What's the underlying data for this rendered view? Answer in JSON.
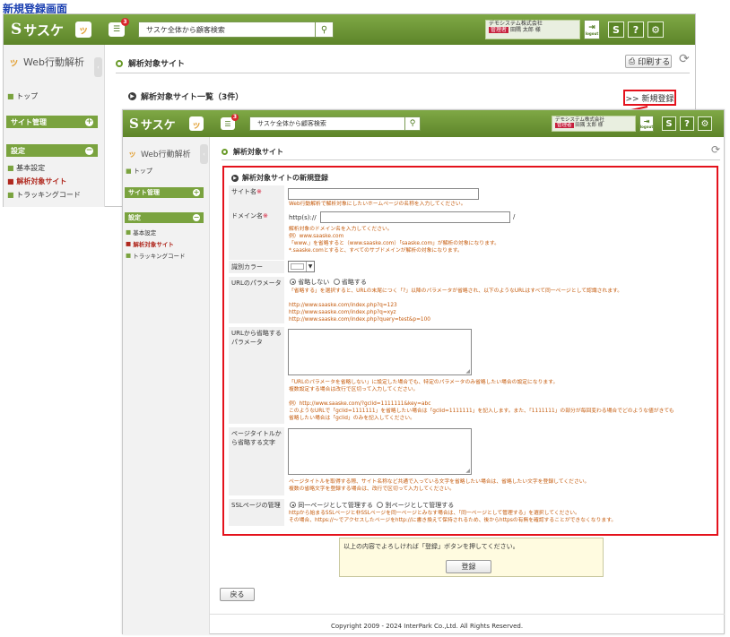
{
  "doc_title": "新規登録画面",
  "brand": {
    "logo": "サスケ",
    "logo_sub": "SASUKE",
    "s": "S"
  },
  "header": {
    "msg_badge": "3",
    "search_placeholder": "サスケ全体から顧客検索",
    "user_company": "デモシステム株式会社",
    "user_role": "管理者",
    "user_name": "田隅 太郎 様",
    "logout_label": "logout",
    "icons": [
      "logo-s-icon",
      "footprint-icon",
      "message-icon",
      "search-icon",
      "logout-icon",
      "sasuke-s-icon",
      "help-icon",
      "gear-icon"
    ]
  },
  "sidebar": {
    "title": "Web行動解析",
    "top": "トップ",
    "site_mgmt": "サイト管理",
    "settings": "設定",
    "items": [
      "基本設定",
      "解析対象サイト",
      "トラッキングコード"
    ]
  },
  "back": {
    "page_title": "解析対象サイト",
    "print": "印刷する",
    "list_title": "解析対象サイト一覧（3件）",
    "new_button": ">> 新規登録"
  },
  "front": {
    "page_title": "解析対象サイト",
    "form_title": "解析対象サイトの新規登録",
    "site_name_label": "サイト名",
    "required_mark": "※",
    "site_name_hint": "Web行動解析で解析対象にしたいホームページの名称を入力してください。",
    "domain_label": "ドメイン名",
    "domain_prefix": "http(s)://",
    "domain_suffix": "/",
    "domain_hint_1": "解析対象のドメイン名を入力してください。",
    "domain_hint_2": "例）www.saaske.com",
    "domain_hint_3": "「www.」を省略すると（www.saaske.com）「saaske.com」が解析の対象になります。",
    "domain_hint_4": "*.saaske.comとすると、すべてのサブドメインが解析の対象になります。",
    "color_label": "識別カラー",
    "url_param_label": "URLのパラメータ",
    "url_param_opt1": "省略しない",
    "url_param_opt2": "省略する",
    "url_param_hint": "「省略する」を選択すると、URLの末尾につく「?」以降のパラメータが省略され、以下のようなURLはすべて同一ページとして認識されます。",
    "url_param_ex1": "http://www.saaske.com/index.php?q=123",
    "url_param_ex2": "http://www.saaske.com/index.php?q=xyz",
    "url_param_ex3": "http://www.saaske.com/index.php?query=test&p=100",
    "omit_param_label": "URLから省略するパラメータ",
    "omit_hint_1": "「URLのパラメータを省略しない」に設定した場合でも、特定のパラメータのみ省略したい場合の設定になります。",
    "omit_hint_2": "複数設定する場合は改行で区切って入力してください。",
    "omit_hint_3": "例）http://www.saaske.com/?gclid=1111111&key=abc",
    "omit_hint_4": "このようなURLで「gclid=1111111」を省略したい場合は「gclid=1111111」を記入します。また、「1111111」の部分が毎回変わる場合でどのような値がきても",
    "omit_hint_5": "省略したい場合は「gclid」のみを記入してください。",
    "title_omit_label": "ページタイトルから省略する文字",
    "title_hint_1": "ページタイトルを取得する際、サイト名称など共通で入っている文字を省略したい場合は、省略したい文字を登録してください。",
    "title_hint_2": "複数の省略文字を登録する場合は、改行で区切って入力してください。",
    "ssl_label": "SSLページの管理",
    "ssl_opt1": "同一ページとして管理する",
    "ssl_opt2": "別ページとして管理する",
    "ssl_hint_1": "httpから始まるSSLページと非SSLページを同一ページとみなす場合は、「同一ページとして管理する」を選択してください。",
    "ssl_hint_2": "その場合、https://〜でアクセスしたページをhttp://に書き換えて保持されるため、後からhttpsの有無を確認することができなくなります。",
    "confirm_text": "以上の内容でよろしければ「登録」ボタンを押してください。",
    "register_button": "登録",
    "back_button": "戻る",
    "copyright": "Copyright 2009 - 2024 InterPark Co.,Ltd. All Rights Reserved."
  },
  "colors": {
    "header_green": "#6a8f35",
    "accent_red": "#e4121c",
    "hint_orange": "#c4590a",
    "section_green": "#7aa33f"
  }
}
